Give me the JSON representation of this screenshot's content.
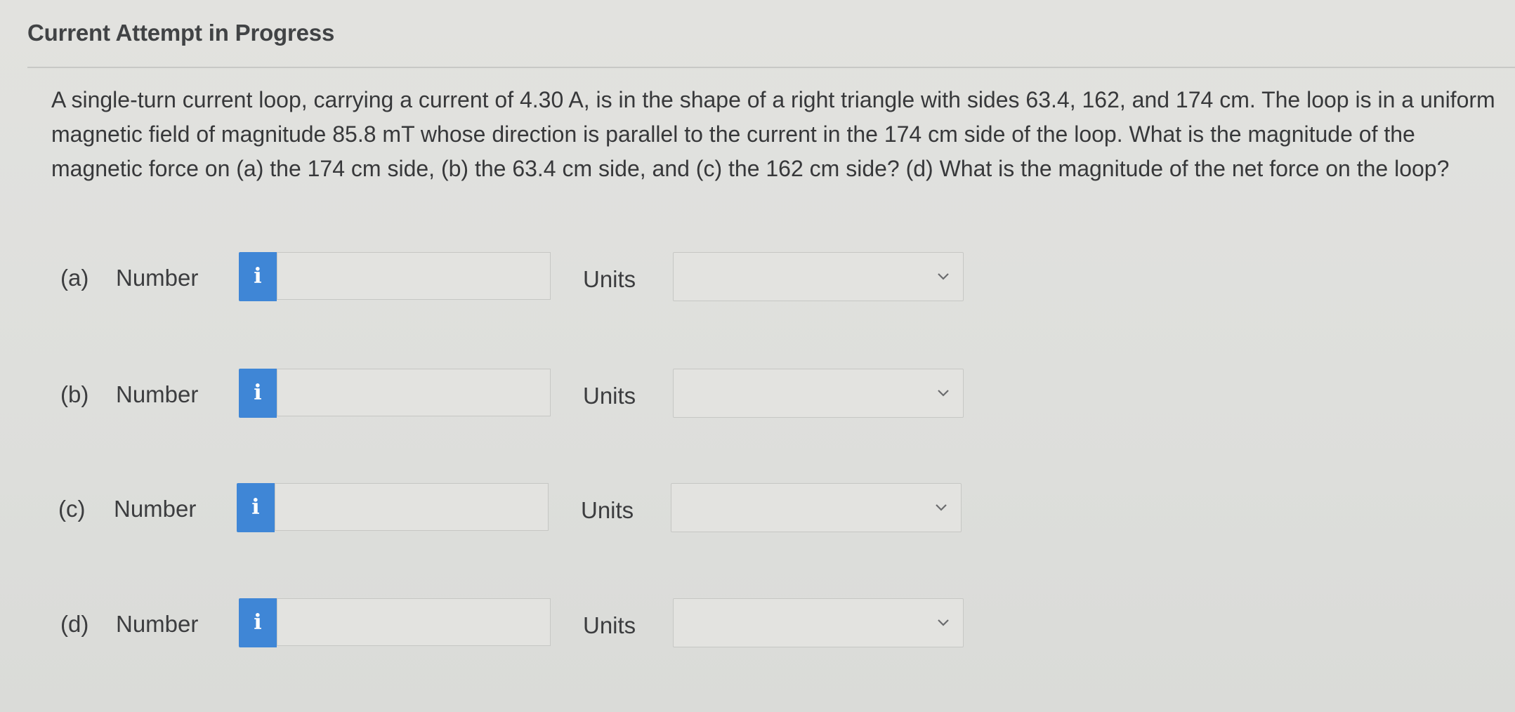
{
  "header": {
    "title": "Current Attempt in Progress"
  },
  "question": {
    "text": "A single-turn current loop, carrying a current of 4.30 A, is in the shape of a right triangle with sides 63.4, 162, and 174 cm. The loop is in a uniform magnetic field of magnitude 85.8 mT whose direction is parallel to the current in the 174 cm side of the loop. What is the magnitude of the magnetic force on (a) the 174 cm side, (b) the 63.4 cm side, and (c) the 162 cm side? (d) What is the magnitude of the net force on the loop?"
  },
  "answers": [
    {
      "part": "(a)",
      "number_label": "Number",
      "info_icon": "i",
      "value": "",
      "units_label": "Units",
      "units_selected": ""
    },
    {
      "part": "(b)",
      "number_label": "Number",
      "info_icon": "i",
      "value": "",
      "units_label": "Units",
      "units_selected": ""
    },
    {
      "part": "(c)",
      "number_label": "Number",
      "info_icon": "i",
      "value": "",
      "units_label": "Units",
      "units_selected": ""
    },
    {
      "part": "(d)",
      "number_label": "Number",
      "info_icon": "i",
      "value": "",
      "units_label": "Units",
      "units_selected": ""
    }
  ],
  "colors": {
    "info_button": "#3f86d6",
    "background": "#dedfdc",
    "text": "#3a3b3d"
  },
  "icons": {
    "info": "info-icon",
    "dropdown": "chevron-down-icon"
  }
}
